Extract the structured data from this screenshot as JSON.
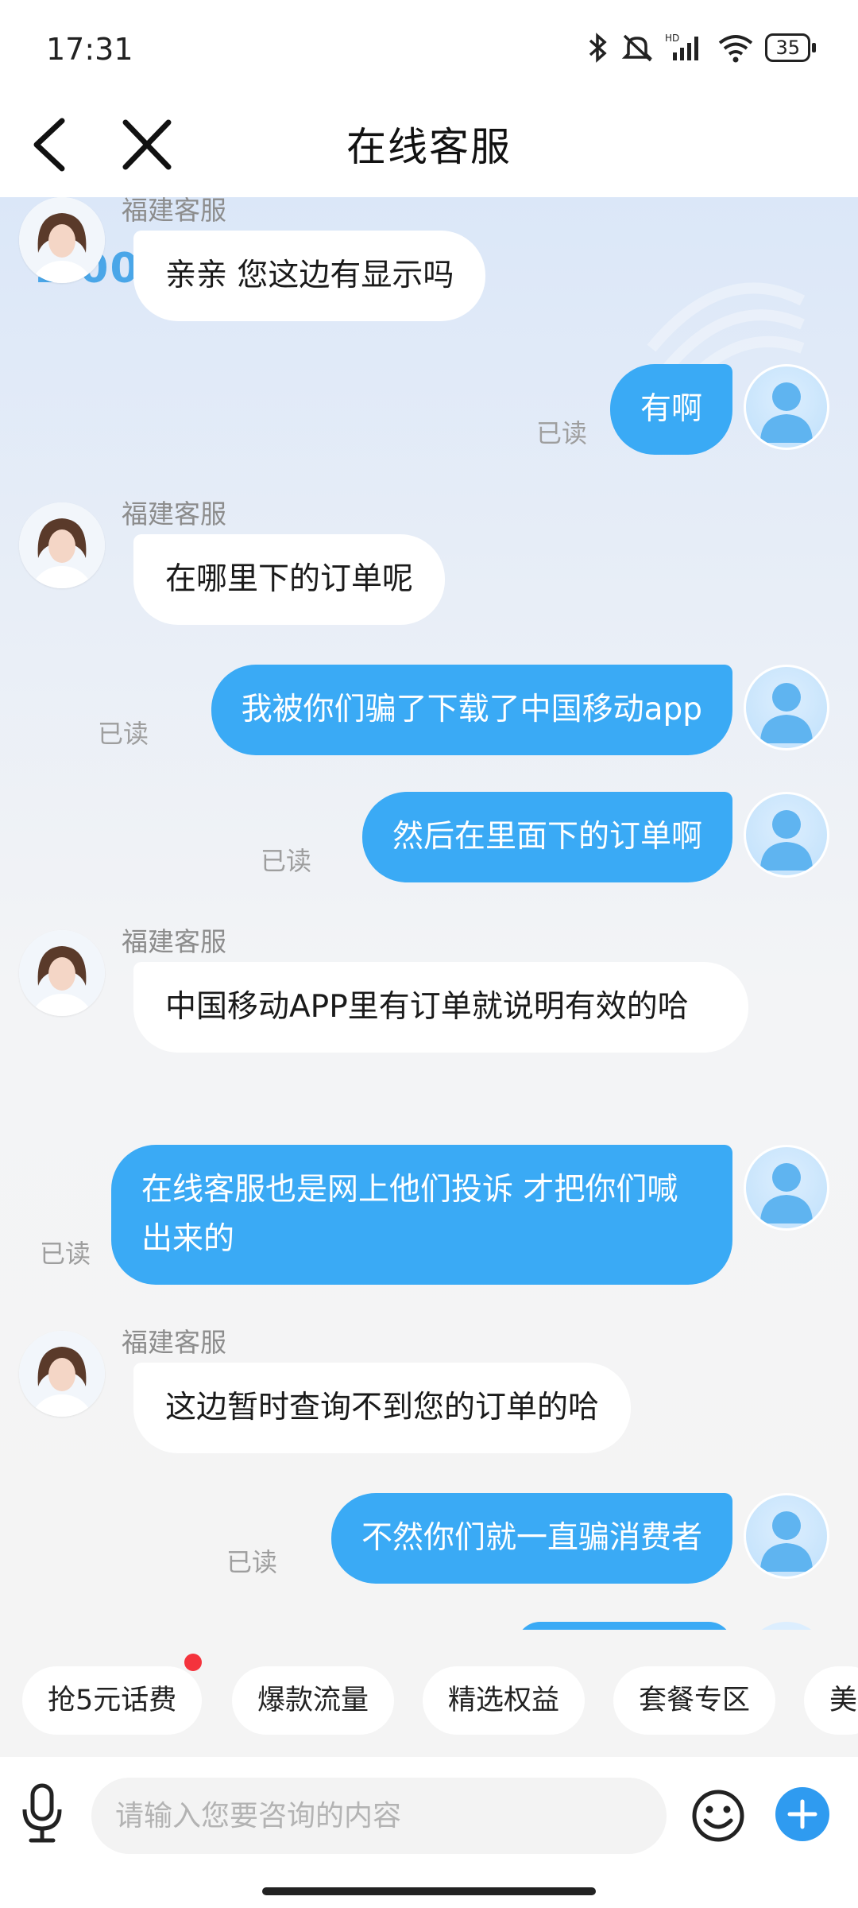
{
  "status_bar": {
    "time": "17:31",
    "battery": "35",
    "network": "HD"
  },
  "header": {
    "title": "在线客服"
  },
  "chat": {
    "watermark_text": "1 0086",
    "agent_name": "福建客服",
    "read_label": "已读",
    "messages": [
      {
        "from": "agent",
        "name": "福建客服",
        "text": "亲亲 您这边有显示吗"
      },
      {
        "from": "user",
        "text": "有啊",
        "status": "已读"
      },
      {
        "from": "agent",
        "name": "福建客服",
        "text": "在哪里下的订单呢"
      },
      {
        "from": "user",
        "text": "我被你们骗了下载了中国移动app",
        "status": "已读"
      },
      {
        "from": "user",
        "text": "然后在里面下的订单啊",
        "status": "已读"
      },
      {
        "from": "agent",
        "name": "福建客服",
        "text": "中国移动APP里有订单就说明有效的哈"
      },
      {
        "from": "user",
        "text": "在线客服也是网上他们投诉 才把你们喊出来的",
        "status": "已读"
      },
      {
        "from": "agent",
        "name": "福建客服",
        "text": "这边暂时查询不到您的订单的哈"
      },
      {
        "from": "user",
        "text": "不然你们就一直骗消费者",
        "status": "已读"
      }
    ]
  },
  "quick_tags": [
    "抢5元话费",
    "爆款流量",
    "精选权益",
    "套餐专区",
    "美"
  ],
  "input": {
    "placeholder": "请输入您要咨询的内容"
  },
  "icons": {
    "back": "back-arrow-icon",
    "close": "close-icon",
    "mic": "microphone-icon",
    "emoji": "emoji-icon",
    "plus": "plus-icon"
  },
  "colors": {
    "user_bubble": "#3aaaf5",
    "agent_bubble": "#ffffff",
    "accent": "#2f9bf0",
    "badge": "#f4333c"
  }
}
